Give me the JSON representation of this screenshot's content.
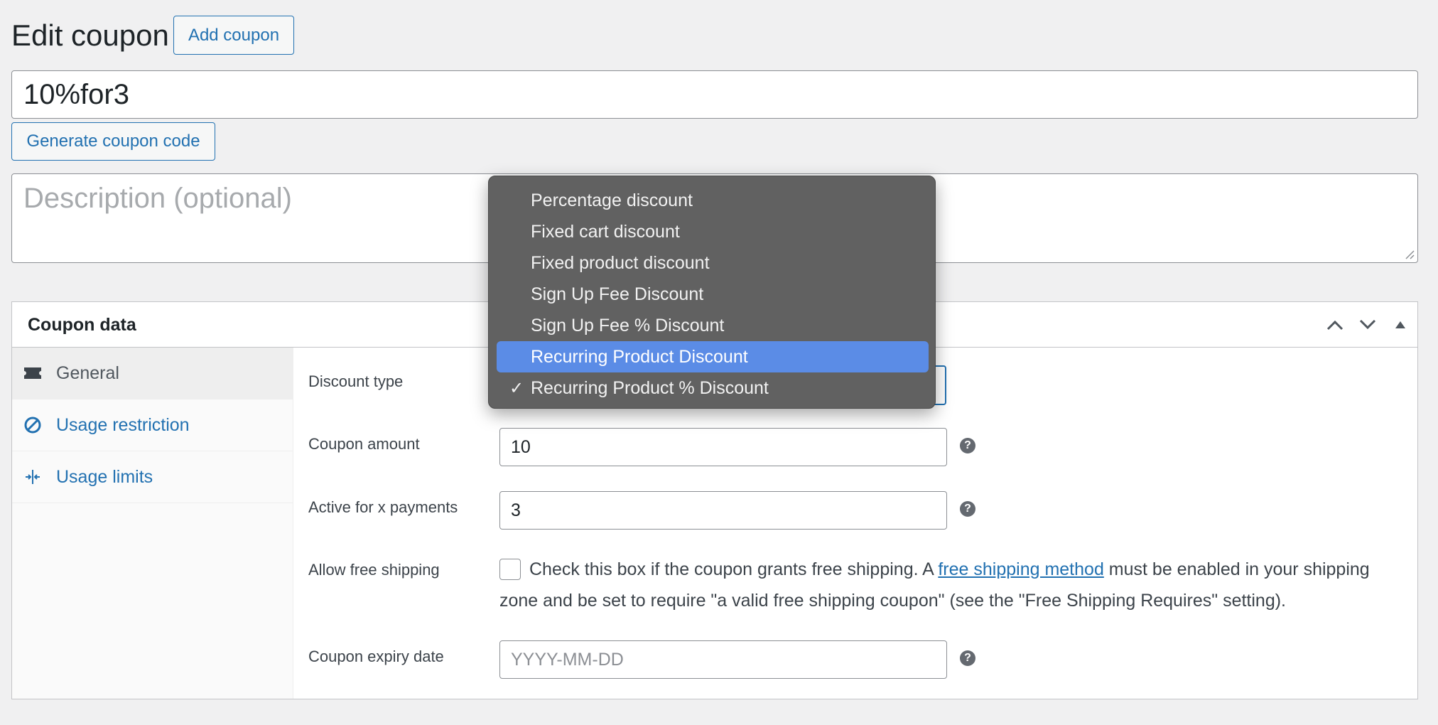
{
  "header": {
    "title": "Edit coupon",
    "add_button": "Add coupon"
  },
  "coupon_code": {
    "value": "10%for3",
    "generate_button": "Generate coupon code"
  },
  "description": {
    "placeholder": "Description (optional)"
  },
  "coupon_data": {
    "title": "Coupon data",
    "tabs": [
      {
        "label": "General",
        "icon": "ticket-icon",
        "active": true
      },
      {
        "label": "Usage restriction",
        "icon": "ban-icon",
        "active": false
      },
      {
        "label": "Usage limits",
        "icon": "arrows-in-icon",
        "active": false
      }
    ],
    "fields": {
      "discount_type": {
        "label": "Discount type",
        "selected": "Recurring Product % Discount"
      },
      "coupon_amount": {
        "label": "Coupon amount",
        "value": "10"
      },
      "active_for": {
        "label": "Active for x payments",
        "value": "3"
      },
      "free_shipping": {
        "label": "Allow free shipping",
        "text_before": "Check this box if the coupon grants free shipping. A ",
        "link": "free shipping method",
        "text_after": " must be enabled in your shipping zone and be set to require \"a valid free shipping coupon\" (see the \"Free Shipping Requires\" setting).",
        "checked": false
      },
      "expiry": {
        "label": "Coupon expiry date",
        "placeholder": "YYYY-MM-DD"
      }
    }
  },
  "dropdown": {
    "options": [
      "Percentage discount",
      "Fixed cart discount",
      "Fixed product discount",
      "Sign Up Fee Discount",
      "Sign Up Fee % Discount",
      "Recurring Product Discount",
      "Recurring Product % Discount"
    ],
    "highlighted": "Recurring Product Discount",
    "checked": "Recurring Product % Discount",
    "check_glyph": "✓"
  },
  "colors": {
    "accent": "#2271b1",
    "highlight": "#5b8ce6",
    "menu_bg": "#616161"
  }
}
